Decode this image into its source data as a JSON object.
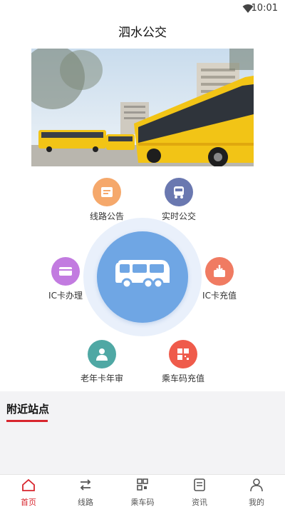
{
  "status": {
    "time": "10:01"
  },
  "header": {
    "title": "泗水公交"
  },
  "banner": {
    "caption": ""
  },
  "features": [
    {
      "label": "线路公告",
      "icon": "notice-icon",
      "color": "#f5a86b"
    },
    {
      "label": "实时公交",
      "icon": "realtime-bus-icon",
      "color": "#6a78b0"
    },
    {
      "label": "IC卡办理",
      "icon": "ic-card-icon",
      "color": "#c27be0"
    },
    {
      "label": "IC卡充值",
      "icon": "card-recharge-icon",
      "color": "#f07b62"
    },
    {
      "label": "老年卡年审",
      "icon": "senior-card-icon",
      "color": "#4fa8a4"
    },
    {
      "label": "乘车码充值",
      "icon": "qr-recharge-icon",
      "color": "#ef5b4b"
    }
  ],
  "center": {
    "icon": "bus-icon",
    "color": "#6fa6e4"
  },
  "nearby": {
    "title": "附近站点"
  },
  "tabs": [
    {
      "label": "首页",
      "icon": "home-icon",
      "active": true
    },
    {
      "label": "线路",
      "icon": "route-icon",
      "active": false
    },
    {
      "label": "乘车码",
      "icon": "qr-code-icon",
      "active": false
    },
    {
      "label": "资讯",
      "icon": "news-icon",
      "active": false
    },
    {
      "label": "我的",
      "icon": "profile-icon",
      "active": false
    }
  ],
  "colors": {
    "accent": "#d8262e",
    "bus_yellow": "#f2c416"
  }
}
